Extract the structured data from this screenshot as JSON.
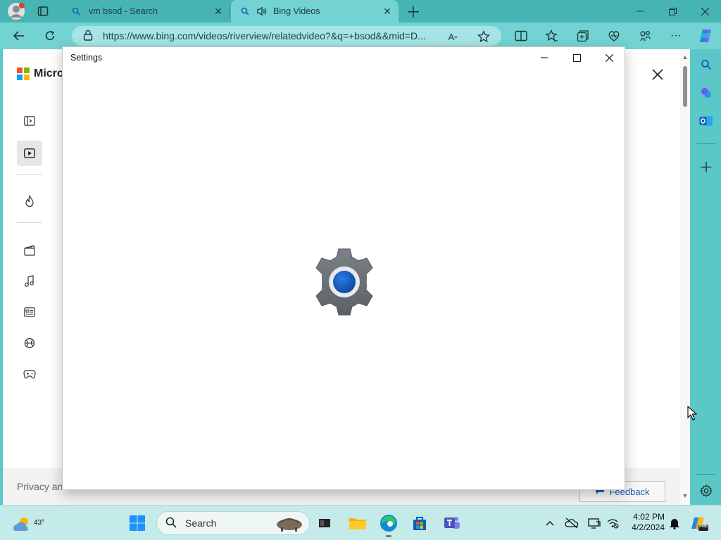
{
  "browser": {
    "tabs": [
      {
        "title": "vm bsod - Search",
        "state": "inactive"
      },
      {
        "title": "Bing Videos",
        "state": "active"
      }
    ],
    "url": "https://www.bing.com/videos/riverview/relatedvideo?&q=+bsod&&mid=D..."
  },
  "page": {
    "brand": "Micros",
    "footer_text": "Privacy an",
    "feedback_label": "Feedback",
    "rail_items": [
      "sidebar-toggle-icon",
      "video-icon",
      "trending-icon",
      "movie-icon",
      "music-icon",
      "news-icon",
      "sports-icon",
      "gaming-icon"
    ]
  },
  "dialog": {
    "title": "Settings"
  },
  "taskbar": {
    "temperature": "43°",
    "search_label": "Search",
    "time": "4:02 PM",
    "date": "4/2/2024",
    "pre_badge": "PRE"
  },
  "colors": {
    "browser_frame": "#47b4b4",
    "toolbar": "#73d3d3",
    "gear_gray": "#6f7479",
    "gear_blue": "#1565c0",
    "taskbar": "#c4eaea"
  }
}
